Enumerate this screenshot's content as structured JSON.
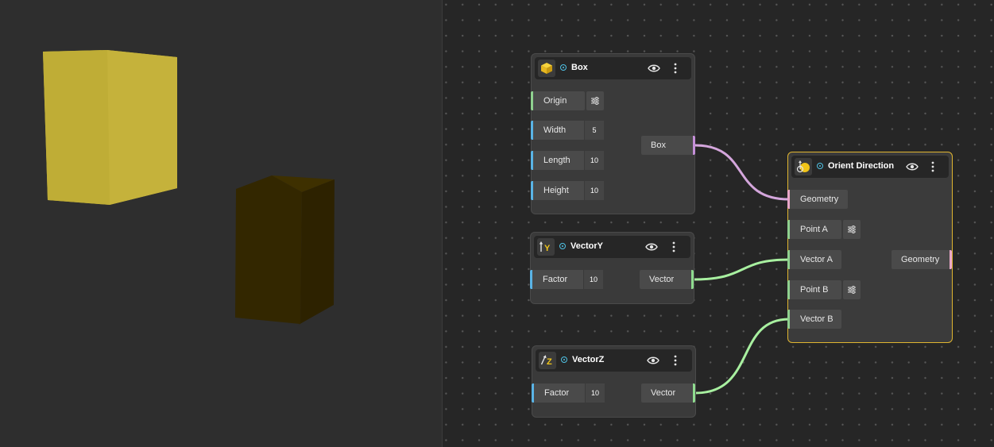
{
  "viewport": {
    "colors": {
      "box_bright": "#c2b038",
      "box_dark": "#342700",
      "background": "#2e2e2e"
    }
  },
  "graph": {
    "nodes": {
      "box": {
        "title": "Box",
        "icon": "cube-icon",
        "inputs": [
          {
            "label": "Origin",
            "control": "settings"
          },
          {
            "label": "Width",
            "value": "5"
          },
          {
            "label": "Length",
            "value": "10"
          },
          {
            "label": "Height",
            "value": "10"
          }
        ],
        "output": "Box"
      },
      "vectory": {
        "title": "VectorY",
        "icon": "y-axis-arrow-icon",
        "icon_letter": "Y",
        "inputs": [
          {
            "label": "Factor",
            "value": "10"
          }
        ],
        "output": "Vector"
      },
      "vectorz": {
        "title": "VectorZ",
        "icon": "z-axis-arrow-icon",
        "icon_letter": "Z",
        "inputs": [
          {
            "label": "Factor",
            "value": "10"
          }
        ],
        "output": "Vector"
      },
      "orient": {
        "title": "Orient Direction",
        "icon": "orient-icon",
        "selected": true,
        "inputs": [
          {
            "label": "Geometry"
          },
          {
            "label": "Point A",
            "control": "settings"
          },
          {
            "label": "Vector A"
          },
          {
            "label": "Point B",
            "control": "settings"
          },
          {
            "label": "Vector B"
          }
        ],
        "output": "Geometry"
      }
    },
    "colors": {
      "wire_geometry": "#d4a6dc",
      "wire_vector": "#a8f0a0",
      "port_number": "#5ab4e6",
      "port_vector": "#8fd18f",
      "port_geometry": "#e8a6c8",
      "selected_border": "#e0b530",
      "status_dot": "#4fc3e6",
      "accent_yellow": "#f0c419"
    }
  }
}
